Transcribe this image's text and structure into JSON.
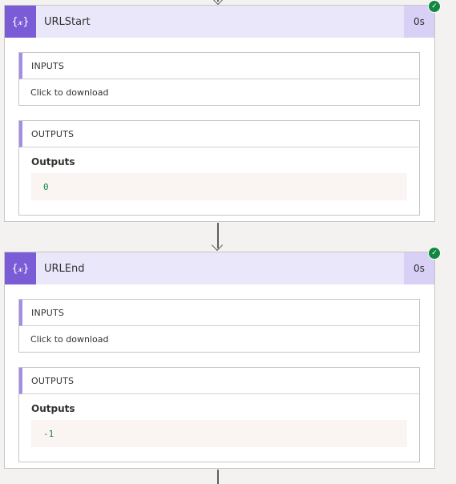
{
  "actions": [
    {
      "name": "URLStart",
      "duration": "0s",
      "icon": "code-braces-icon",
      "icon_glyph": "{𝓍}",
      "status": "succeeded",
      "inputs": {
        "header": "INPUTS",
        "link_text": "Click to download"
      },
      "outputs": {
        "header": "OUTPUTS",
        "label": "Outputs",
        "value": "0"
      }
    },
    {
      "name": "URLEnd",
      "duration": "0s",
      "icon": "code-braces-icon",
      "icon_glyph": "{𝓍}",
      "status": "succeeded",
      "inputs": {
        "header": "INPUTS",
        "link_text": "Click to download"
      },
      "outputs": {
        "header": "OUTPUTS",
        "label": "Outputs",
        "value": "-1"
      }
    }
  ],
  "colors": {
    "header_bg": "#ebe7fb",
    "icon_bg": "#7a5cd6",
    "duration_bg": "#d8d0f5",
    "success": "#128741",
    "section_accent": "#a28ee6",
    "output_value_text": "#128741"
  }
}
